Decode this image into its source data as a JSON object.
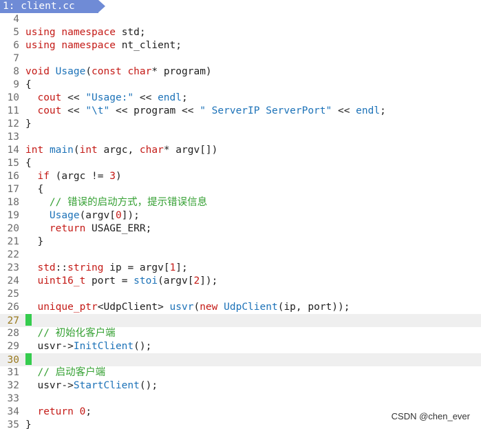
{
  "tab": {
    "label": "1: client.cc"
  },
  "colors": {
    "keyword": "#c41a16",
    "type": "#c41a16",
    "function": "#1c72b8",
    "string": "#1c72b8",
    "number": "#c41a16",
    "comment": "#35a033",
    "plain": "#1e1e1e"
  },
  "cursor_lines": [
    27,
    30
  ],
  "watermark": "CSDN @chen_ever",
  "lines": [
    {
      "n": "4",
      "tokens": []
    },
    {
      "n": "5",
      "tokens": [
        [
          "using",
          "keyword"
        ],
        [
          " ",
          "plain"
        ],
        [
          "namespace",
          "keyword"
        ],
        [
          " std;",
          "plain"
        ]
      ]
    },
    {
      "n": "6",
      "tokens": [
        [
          "using",
          "keyword"
        ],
        [
          " ",
          "plain"
        ],
        [
          "namespace",
          "keyword"
        ],
        [
          " nt_client;",
          "plain"
        ]
      ]
    },
    {
      "n": "7",
      "tokens": []
    },
    {
      "n": "8",
      "tokens": [
        [
          "void",
          "type"
        ],
        [
          " ",
          "plain"
        ],
        [
          "Usage",
          "function"
        ],
        [
          "(",
          "plain"
        ],
        [
          "const",
          "keyword"
        ],
        [
          " ",
          "plain"
        ],
        [
          "char",
          "type"
        ],
        [
          "* program)",
          "plain"
        ]
      ]
    },
    {
      "n": "9",
      "tokens": [
        [
          "{",
          "plain"
        ]
      ]
    },
    {
      "n": "10",
      "tokens": [
        [
          "  ",
          "plain"
        ],
        [
          "cout",
          "keyword"
        ],
        [
          " << ",
          "plain"
        ],
        [
          "\"Usage:\"",
          "string"
        ],
        [
          " << ",
          "plain"
        ],
        [
          "endl",
          "function"
        ],
        [
          ";",
          "plain"
        ]
      ]
    },
    {
      "n": "11",
      "tokens": [
        [
          "  ",
          "plain"
        ],
        [
          "cout",
          "keyword"
        ],
        [
          " << ",
          "plain"
        ],
        [
          "\"\\t\"",
          "string"
        ],
        [
          " << program << ",
          "plain"
        ],
        [
          "\" ServerIP ServerPort\"",
          "string"
        ],
        [
          " << ",
          "plain"
        ],
        [
          "endl",
          "function"
        ],
        [
          ";",
          "plain"
        ]
      ]
    },
    {
      "n": "12",
      "tokens": [
        [
          "}",
          "plain"
        ]
      ]
    },
    {
      "n": "13",
      "tokens": []
    },
    {
      "n": "14",
      "tokens": [
        [
          "int",
          "type"
        ],
        [
          " ",
          "plain"
        ],
        [
          "main",
          "function"
        ],
        [
          "(",
          "plain"
        ],
        [
          "int",
          "type"
        ],
        [
          " argc, ",
          "plain"
        ],
        [
          "char",
          "type"
        ],
        [
          "* argv[])",
          "plain"
        ]
      ]
    },
    {
      "n": "15",
      "tokens": [
        [
          "{",
          "plain"
        ]
      ]
    },
    {
      "n": "16",
      "tokens": [
        [
          "  ",
          "plain"
        ],
        [
          "if",
          "keyword"
        ],
        [
          " (argc != ",
          "plain"
        ],
        [
          "3",
          "number"
        ],
        [
          ")",
          "plain"
        ]
      ]
    },
    {
      "n": "17",
      "tokens": [
        [
          "  {",
          "plain"
        ]
      ]
    },
    {
      "n": "18",
      "tokens": [
        [
          "    ",
          "plain"
        ],
        [
          "// 错误的启动方式，提示错误信息",
          "comment"
        ]
      ]
    },
    {
      "n": "19",
      "tokens": [
        [
          "    ",
          "plain"
        ],
        [
          "Usage",
          "function"
        ],
        [
          "(argv[",
          "plain"
        ],
        [
          "0",
          "number"
        ],
        [
          "]);",
          "plain"
        ]
      ]
    },
    {
      "n": "20",
      "tokens": [
        [
          "    ",
          "plain"
        ],
        [
          "return",
          "keyword"
        ],
        [
          " USAGE_ERR;",
          "plain"
        ]
      ]
    },
    {
      "n": "21",
      "tokens": [
        [
          "  }",
          "plain"
        ]
      ]
    },
    {
      "n": "22",
      "tokens": []
    },
    {
      "n": "23",
      "tokens": [
        [
          "  ",
          "plain"
        ],
        [
          "std",
          "keyword"
        ],
        [
          "::",
          "plain"
        ],
        [
          "string",
          "keyword"
        ],
        [
          " ip = argv[",
          "plain"
        ],
        [
          "1",
          "number"
        ],
        [
          "];",
          "plain"
        ]
      ]
    },
    {
      "n": "24",
      "tokens": [
        [
          "  ",
          "plain"
        ],
        [
          "uint16_t",
          "type"
        ],
        [
          " port = ",
          "plain"
        ],
        [
          "stoi",
          "function"
        ],
        [
          "(argv[",
          "plain"
        ],
        [
          "2",
          "number"
        ],
        [
          "]);",
          "plain"
        ]
      ]
    },
    {
      "n": "25",
      "tokens": []
    },
    {
      "n": "26",
      "tokens": [
        [
          "  ",
          "plain"
        ],
        [
          "unique_ptr",
          "keyword"
        ],
        [
          "<UdpClient> ",
          "plain"
        ],
        [
          "usvr",
          "function"
        ],
        [
          "(",
          "plain"
        ],
        [
          "new",
          "keyword"
        ],
        [
          " ",
          "plain"
        ],
        [
          "UdpClient",
          "function"
        ],
        [
          "(ip, port));",
          "plain"
        ]
      ]
    },
    {
      "n": "27",
      "tokens": [],
      "cursor": true
    },
    {
      "n": "28",
      "tokens": [
        [
          "  ",
          "plain"
        ],
        [
          "// 初始化客户端",
          "comment"
        ]
      ]
    },
    {
      "n": "29",
      "tokens": [
        [
          "  usvr->",
          "plain"
        ],
        [
          "InitClient",
          "function"
        ],
        [
          "();",
          "plain"
        ]
      ]
    },
    {
      "n": "30",
      "tokens": [],
      "cursor": true
    },
    {
      "n": "31",
      "tokens": [
        [
          "  ",
          "plain"
        ],
        [
          "// 启动客户端",
          "comment"
        ]
      ]
    },
    {
      "n": "32",
      "tokens": [
        [
          "  usvr->",
          "plain"
        ],
        [
          "StartClient",
          "function"
        ],
        [
          "();",
          "plain"
        ]
      ]
    },
    {
      "n": "33",
      "tokens": []
    },
    {
      "n": "34",
      "tokens": [
        [
          "  ",
          "plain"
        ],
        [
          "return",
          "keyword"
        ],
        [
          " ",
          "plain"
        ],
        [
          "0",
          "number"
        ],
        [
          ";",
          "plain"
        ]
      ]
    },
    {
      "n": "35",
      "tokens": [
        [
          "}",
          "plain"
        ]
      ]
    }
  ]
}
